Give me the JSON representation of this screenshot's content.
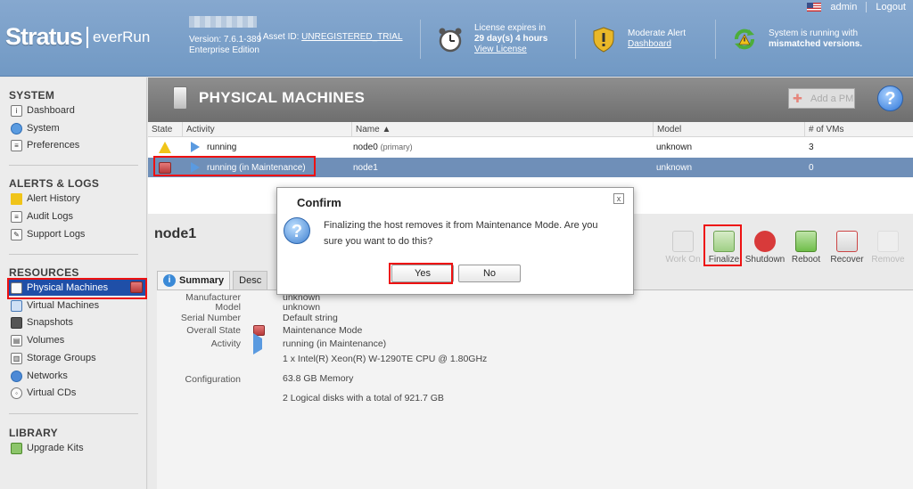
{
  "header": {
    "logo_main": "Stratus",
    "logo_sub": "everRun",
    "version": "Version: 7.6.1-389",
    "edition": "Enterprise Edition",
    "asset_prefix": "| Asset ID:",
    "asset_id": "UNREGISTERED_TRIAL",
    "license_line1": "License expires in",
    "license_line2": "29 day(s) 4 hours",
    "license_link": "View License",
    "alert_line1": "Moderate Alert",
    "alert_link": "Dashboard",
    "status_line1": "System is running with",
    "status_line2": "mismatched versions.",
    "user": "admin",
    "logout": "Logout"
  },
  "sidebar": {
    "system_title": "SYSTEM",
    "system_items": [
      {
        "label": "Dashboard"
      },
      {
        "label": "System"
      },
      {
        "label": "Preferences"
      }
    ],
    "alerts_title": "ALERTS & LOGS",
    "alerts_items": [
      {
        "label": "Alert History"
      },
      {
        "label": "Audit Logs"
      },
      {
        "label": "Support Logs"
      }
    ],
    "resources_title": "RESOURCES",
    "resources_items": [
      {
        "label": "Physical Machines"
      },
      {
        "label": "Virtual Machines"
      },
      {
        "label": "Snapshots"
      },
      {
        "label": "Volumes"
      },
      {
        "label": "Storage Groups"
      },
      {
        "label": "Networks"
      },
      {
        "label": "Virtual CDs"
      }
    ],
    "library_title": "LIBRARY",
    "library_items": [
      {
        "label": "Upgrade Kits"
      }
    ]
  },
  "main": {
    "title": "PHYSICAL MACHINES",
    "add_pm": "Add a PM",
    "help": "?",
    "columns": [
      "State",
      "Activity",
      "Name ▲",
      "Model",
      "# of VMs"
    ],
    "rows": [
      {
        "activity": "running",
        "name": "node0",
        "name_note": "(primary)",
        "model": "unknown",
        "vms": "3"
      },
      {
        "activity": "running (in Maintenance)",
        "name": "node1",
        "name_note": "",
        "model": "unknown",
        "vms": "0"
      }
    ],
    "node_title": "node1",
    "actions": [
      "Work On",
      "Finalize",
      "Shutdown",
      "Reboot",
      "Recover",
      "Remove"
    ],
    "tabs": [
      "Summary",
      "Desc"
    ],
    "summary": {
      "manufacturer_label": "Manufacturer",
      "manufacturer": "unknown",
      "model_label": "Model",
      "model": "unknown",
      "serial_label": "Serial Number",
      "serial": "Default string",
      "overall_label": "Overall State",
      "overall": "Maintenance Mode",
      "activity_label": "Activity",
      "activity": "running (in Maintenance)",
      "cpu": "1 x Intel(R) Xeon(R) W-1290TE CPU @ 1.80GHz",
      "config_label": "Configuration",
      "memory": "63.8 GB Memory",
      "disks": "2 Logical disks with a total of 921.7 GB"
    }
  },
  "modal": {
    "title": "Confirm",
    "close": "x",
    "message": "Finalizing the host removes it from Maintenance Mode. Are you sure you want to do this?",
    "yes": "Yes",
    "no": "No"
  },
  "colors": {
    "header": "#7a9fc8",
    "selection": "#6f8fb8",
    "nav_selected": "#1f4fa8",
    "highlight": "#ee1111"
  }
}
